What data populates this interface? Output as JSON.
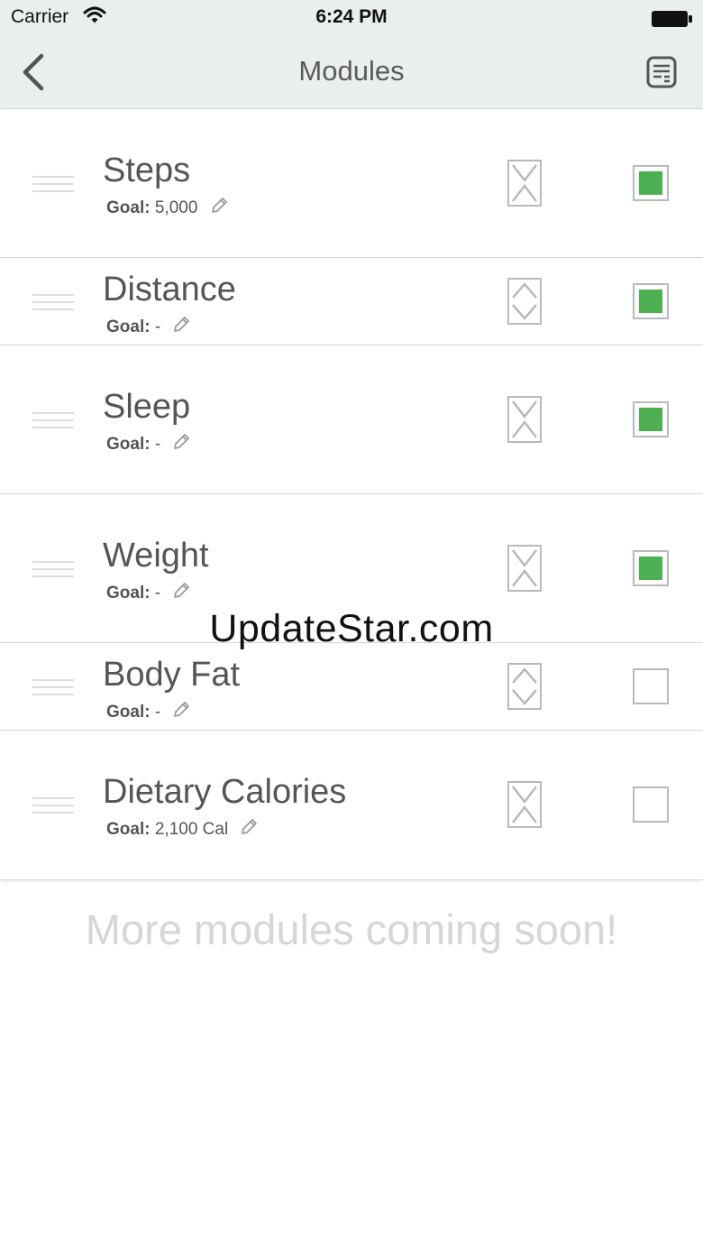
{
  "status_bar": {
    "carrier": "Carrier",
    "time": "6:24 PM",
    "wifi_icon": "wifi-icon",
    "battery_icon": "battery-icon"
  },
  "nav": {
    "title": "Modules",
    "back_icon": "chevron-left-icon",
    "right_icon": "list-icon"
  },
  "modules": [
    {
      "name": "Steps",
      "goal_label": "Goal:",
      "goal_value": "5,000",
      "enabled": true,
      "sort_icon": "sort-collapse-icon"
    },
    {
      "name": "Distance",
      "goal_label": "Goal:",
      "goal_value": "-",
      "enabled": true,
      "sort_icon": "sort-expand-icon"
    },
    {
      "name": "Sleep",
      "goal_label": "Goal:",
      "goal_value": "-",
      "enabled": true,
      "sort_icon": "sort-collapse-icon"
    },
    {
      "name": "Weight",
      "goal_label": "Goal:",
      "goal_value": "-",
      "enabled": true,
      "sort_icon": "sort-collapse-icon"
    },
    {
      "name": "Body Fat",
      "goal_label": "Goal:",
      "goal_value": "-",
      "enabled": false,
      "sort_icon": "sort-expand-icon"
    },
    {
      "name": "Dietary Calories",
      "goal_label": "Goal:",
      "goal_value": "2,100 Cal",
      "enabled": false,
      "sort_icon": "sort-collapse-icon"
    }
  ],
  "footer": {
    "text": "More modules coming soon!"
  },
  "watermark": {
    "text": "UpdateStar.com"
  },
  "colors": {
    "bar_background": "#ebeeef",
    "checkbox_fill": "#4caf50",
    "footer_text": "#d6d6d6"
  }
}
